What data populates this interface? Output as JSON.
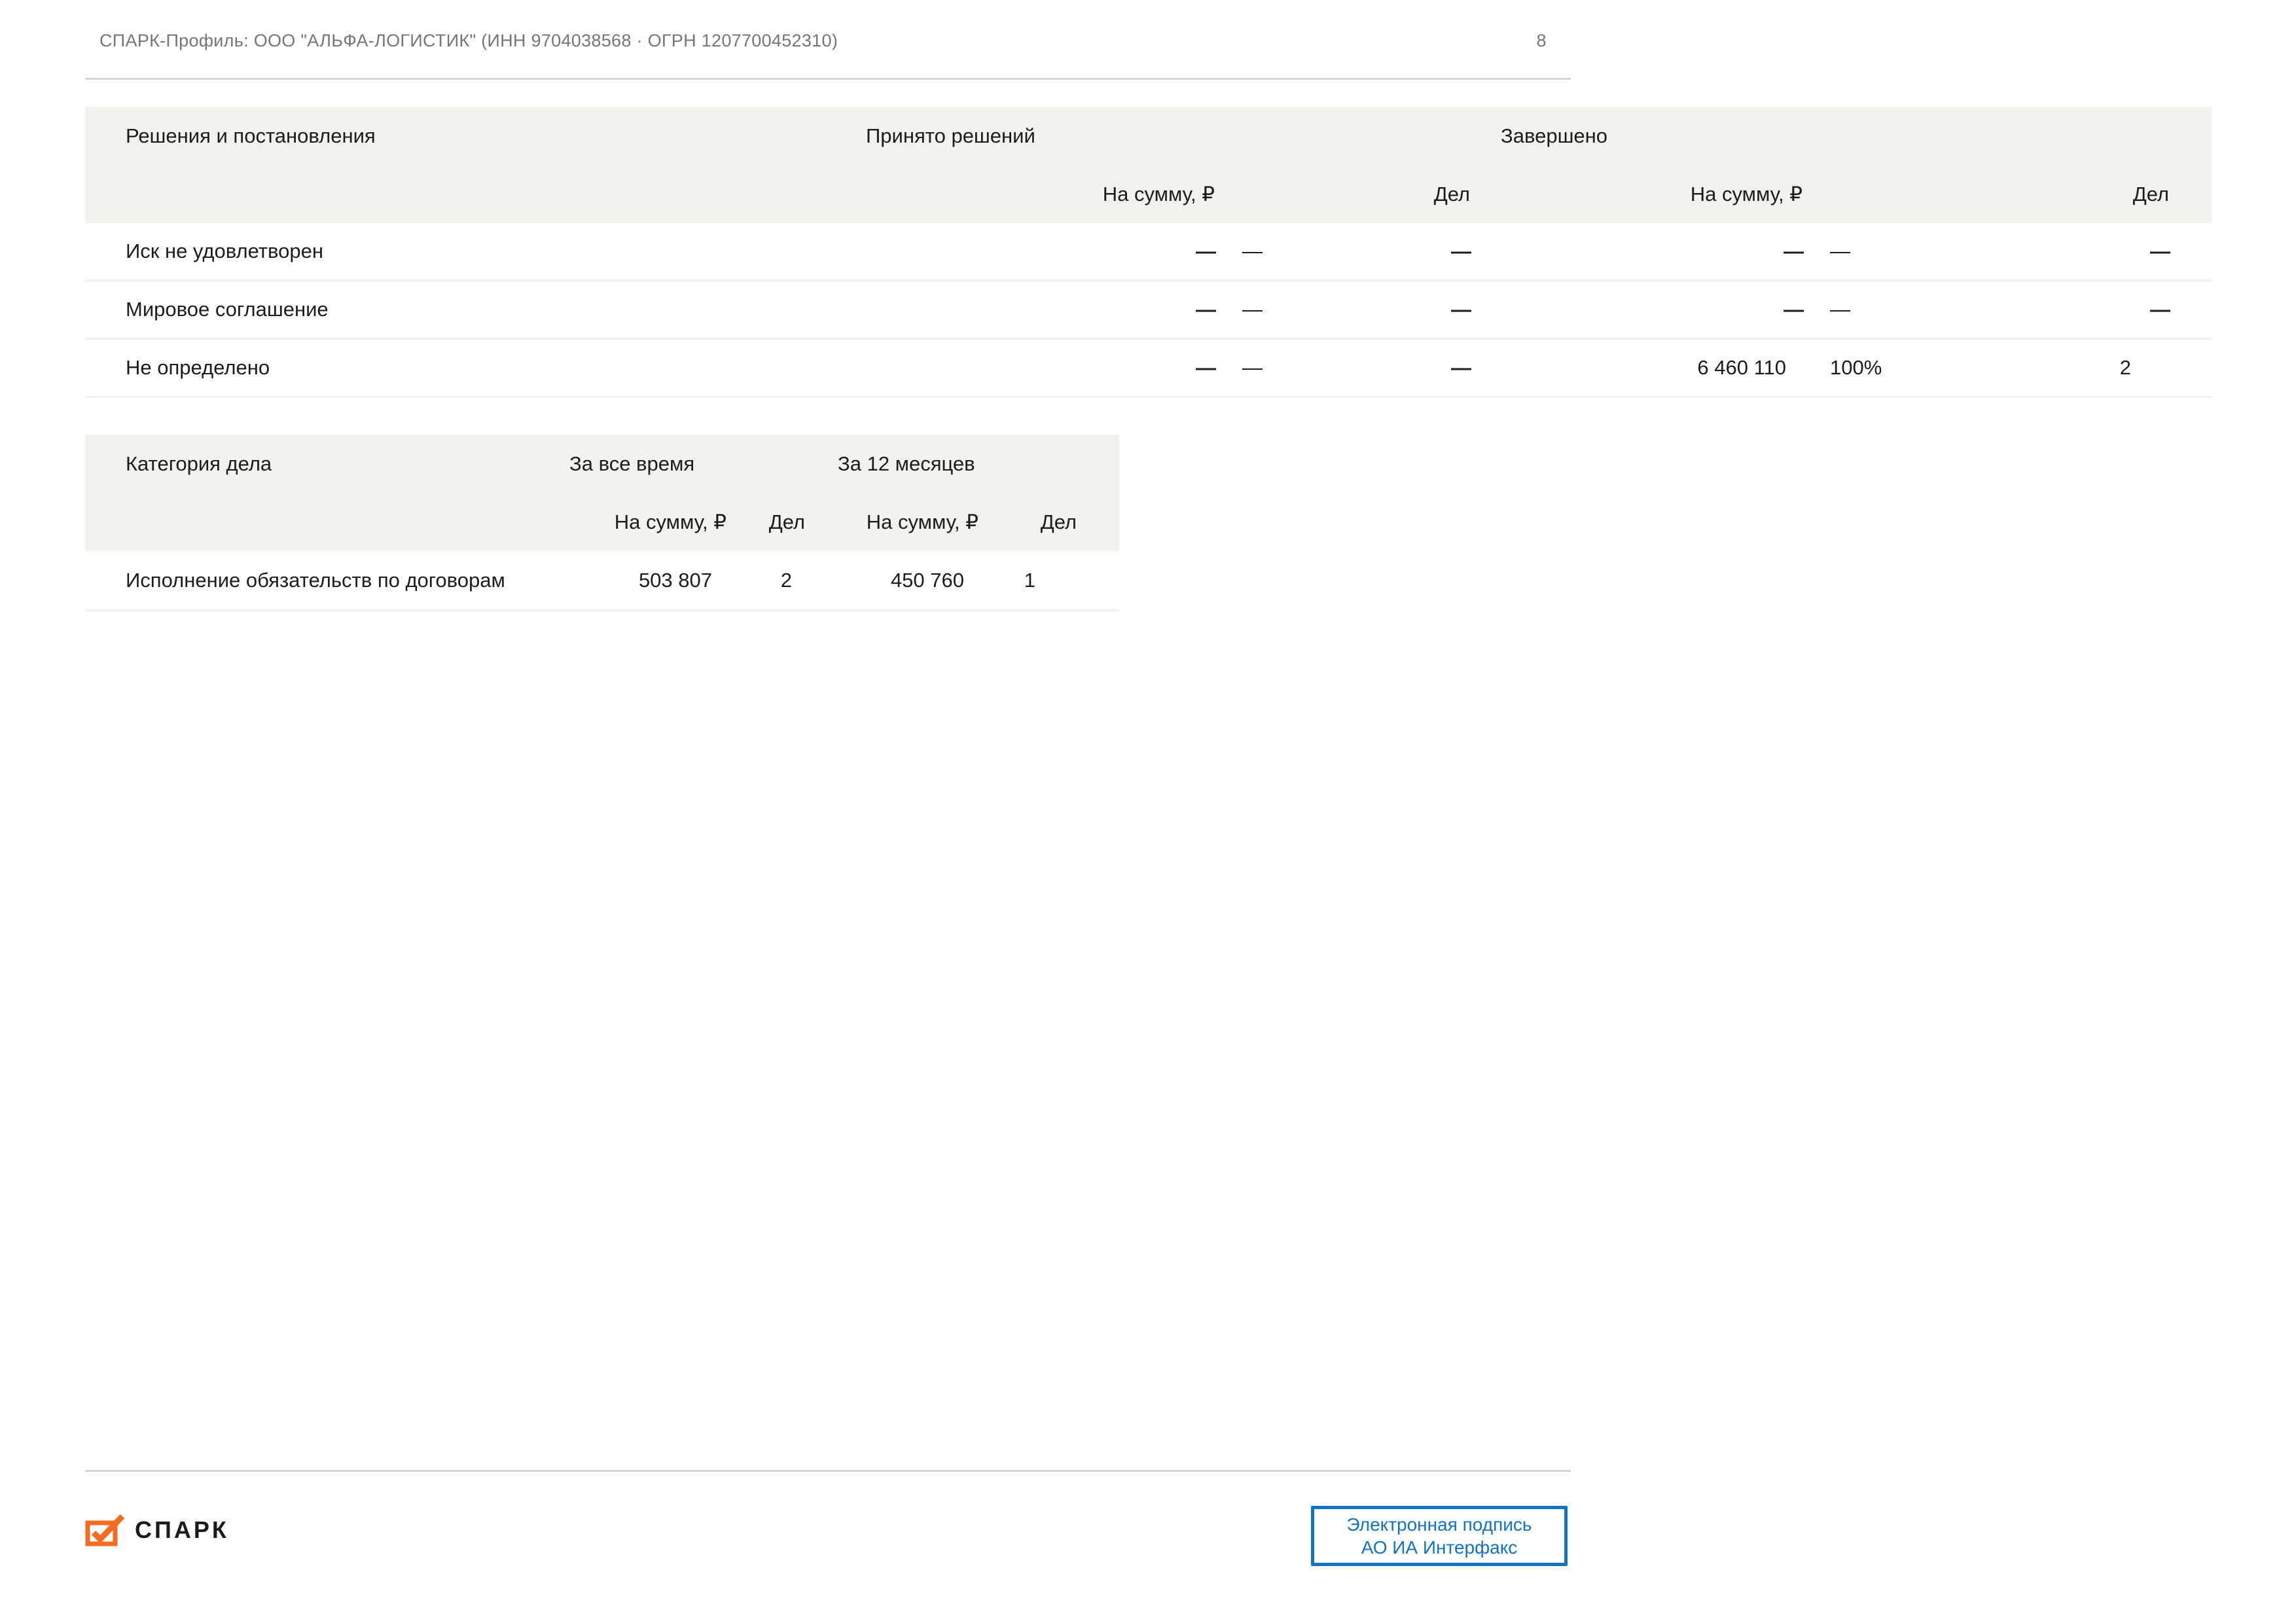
{
  "header": {
    "title": "СПАРК-Профиль: ООО \"АЛЬФА-ЛОГИСТИК\" (ИНН 9704038568 · ОГРН 1207700452310)",
    "page_number": "8"
  },
  "decisions_table": {
    "title": "Решения и постановления",
    "group1": "Принято решений",
    "group2": "Завершено",
    "col_sum": "На сумму, ₽",
    "col_cases": "Дел",
    "rows": [
      {
        "label": "Иск не удовлетворен",
        "g1_sum": "—",
        "g1_pct": "—",
        "g1_cases": "—",
        "g2_sum": "—",
        "g2_pct": "—",
        "g2_cases": "—"
      },
      {
        "label": "Мировое соглашение",
        "g1_sum": "—",
        "g1_pct": "—",
        "g1_cases": "—",
        "g2_sum": "—",
        "g2_pct": "—",
        "g2_cases": "—"
      },
      {
        "label": "Не определено",
        "g1_sum": "—",
        "g1_pct": "—",
        "g1_cases": "—",
        "g2_sum": "6 460 110",
        "g2_pct": "100%",
        "g2_cases": "2"
      }
    ]
  },
  "category_table": {
    "title": "Категория дела",
    "group1": "За все время",
    "group2": "За 12 месяцев",
    "col_sum": "На сумму, ₽",
    "col_cases": "Дел",
    "rows": [
      {
        "label": "Исполнение обязательств по договорам",
        "all_sum": "503 807",
        "all_cases": "2",
        "y12_sum": "450 760",
        "y12_cases": "1"
      }
    ]
  },
  "footer": {
    "logo_text": "СПАРК",
    "signature_line1": "Электронная подпись",
    "signature_line2": "АО ИА Интерфакс"
  },
  "colors": {
    "accent_blue": "#0f78c8",
    "button_blue": "#1173c2",
    "brand_orange": "#f36c21",
    "table_header_bg": "#f4f2ec"
  }
}
